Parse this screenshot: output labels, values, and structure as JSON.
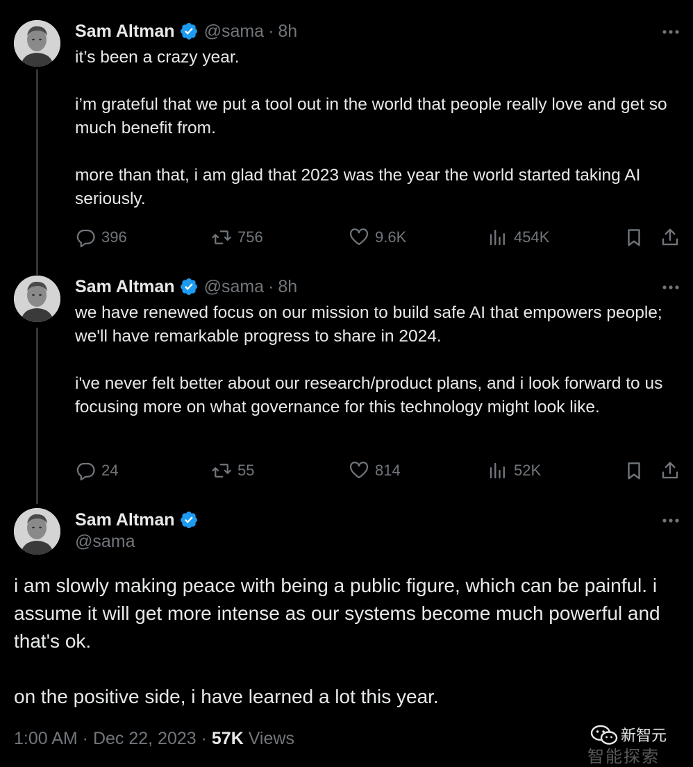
{
  "colors": {
    "background": "#000000",
    "text": "#e7e9ea",
    "muted": "#71767b",
    "verified": "#1d9bf0",
    "thread_line": "#333639"
  },
  "tweets": [
    {
      "name": "Sam Altman",
      "handle": "@sama",
      "separator": "·",
      "time": "8h",
      "paragraphs": [
        "it’s been a crazy year.",
        "i’m grateful that we put a tool out in the world that people really love and get so much benefit from.",
        "more than that, i am glad that 2023 was the year the world started taking AI seriously."
      ],
      "stats": {
        "replies": "396",
        "retweets": "756",
        "likes": "9.6K",
        "views": "454K"
      }
    },
    {
      "name": "Sam Altman",
      "handle": "@sama",
      "separator": "·",
      "time": "8h",
      "paragraphs": [
        "we have renewed focus on our mission to build safe AI that empowers people; we'll have remarkable progress to share in 2024.",
        "i've never felt better about our research/product plans, and i look forward to us focusing more on what governance for this technology might look like."
      ],
      "stats": {
        "replies": "24",
        "retweets": "55",
        "likes": "814",
        "views": "52K"
      }
    }
  ],
  "main_tweet": {
    "name": "Sam Altman",
    "handle": "@sama",
    "paragraphs": [
      "i am slowly making peace with being a public figure, which can be painful. i assume it will get more intense as our systems become much powerful and that's ok.",
      "on the positive side, i have learned a lot this year."
    ],
    "timestamp": "1:00 AM · Dec 22, 2023 · ",
    "views_count": "57K",
    "views_label": " Views"
  },
  "watermark": {
    "text": "新智元",
    "faded_text": "智能探索"
  }
}
